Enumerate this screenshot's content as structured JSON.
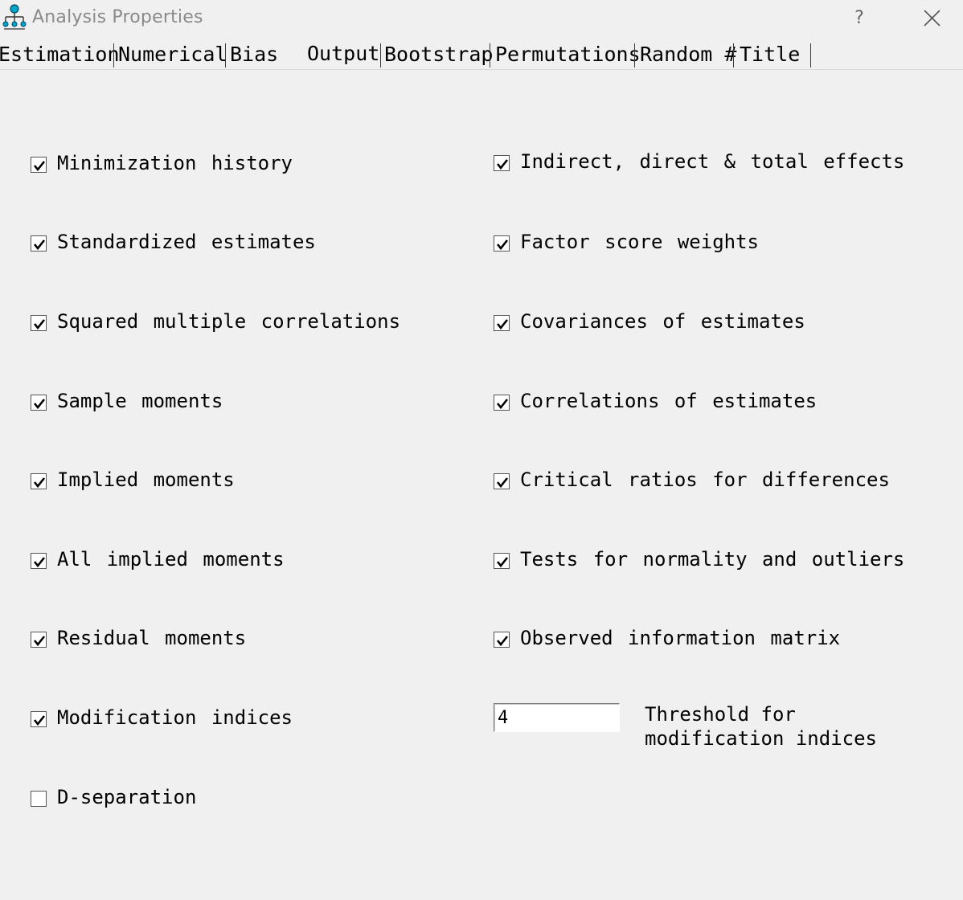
{
  "window": {
    "title": "Analysis Properties",
    "help_label": "?",
    "icon": "network-diagram-icon"
  },
  "tabs": [
    {
      "label": "Estimation",
      "active": false
    },
    {
      "label": "Numerical",
      "active": false
    },
    {
      "label": "Bias",
      "active": false
    },
    {
      "label": "Output",
      "active": true
    },
    {
      "label": "Bootstrap",
      "active": false
    },
    {
      "label": "Permutations",
      "active": false
    },
    {
      "label": "Random #",
      "active": false
    },
    {
      "label": "Title",
      "active": false
    }
  ],
  "options_left": [
    {
      "label": "Minimization history",
      "checked": true
    },
    {
      "label": "Standardized estimates",
      "checked": true
    },
    {
      "label": "Squared multiple correlations",
      "checked": true
    },
    {
      "label": "Sample moments",
      "checked": true
    },
    {
      "label": "Implied moments",
      "checked": true
    },
    {
      "label": "All implied moments",
      "checked": true
    },
    {
      "label": "Residual moments",
      "checked": true
    },
    {
      "label": "Modification indices",
      "checked": true
    },
    {
      "label": "D-separation",
      "checked": false
    }
  ],
  "options_right": [
    {
      "label": "Indirect, direct & total effects",
      "checked": true
    },
    {
      "label": "Factor score weights",
      "checked": true
    },
    {
      "label": "Covariances of estimates",
      "checked": true
    },
    {
      "label": "Correlations of estimates",
      "checked": true
    },
    {
      "label": "Critical ratios for differences",
      "checked": true
    },
    {
      "label": "Tests for normality and outliers",
      "checked": true
    },
    {
      "label": "Observed information matrix",
      "checked": true
    }
  ],
  "threshold": {
    "value": "4",
    "label_line1": "Threshold for",
    "label_line2": "modification indices"
  },
  "colors": {
    "background": "#f0f0f0",
    "icon_accent": "#00a6c8"
  }
}
